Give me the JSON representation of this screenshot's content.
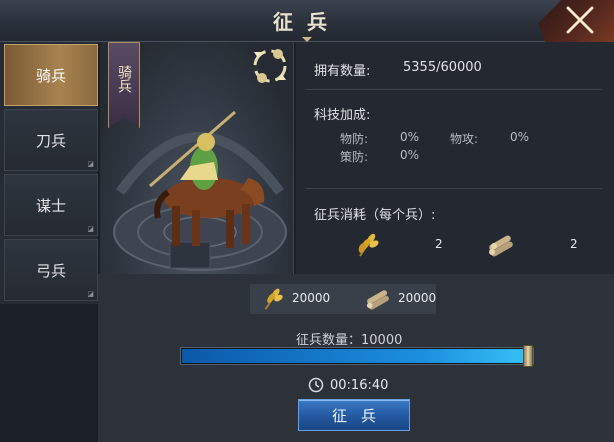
{
  "window": {
    "title": "征兵"
  },
  "tabs": [
    {
      "label": "骑兵",
      "active": true
    },
    {
      "label": "刀兵",
      "active": false
    },
    {
      "label": "谋士",
      "active": false
    },
    {
      "label": "弓兵",
      "active": false
    }
  ],
  "portrait": {
    "unit_name": "骑兵",
    "swap_icon": "rotate-arrows-icon"
  },
  "info": {
    "owned_label": "拥有数量:",
    "owned_value": "5355/60000",
    "tech_label": "科技加成:",
    "stats": [
      {
        "label": "物防:",
        "value": "0%"
      },
      {
        "label": "物攻:",
        "value": "0%"
      },
      {
        "label": "策防:",
        "value": "0%"
      }
    ],
    "cost_label": "征兵消耗（每个兵）:",
    "per_unit_cost": [
      {
        "resource": "grain-icon",
        "value": "2"
      },
      {
        "resource": "wood-icon",
        "value": "2"
      }
    ]
  },
  "total_cost": [
    {
      "resource": "grain-icon",
      "value": "20000"
    },
    {
      "resource": "wood-icon",
      "value": "20000"
    }
  ],
  "recruit": {
    "count_label": "征兵数量：10000",
    "slider_fraction": 1.0,
    "time": "00:16:40",
    "button_label": "征兵"
  },
  "colors": {
    "accent_gold": "#c6a05a",
    "slider_blue": "#1c8fe0",
    "button_blue": "#2358a0"
  }
}
